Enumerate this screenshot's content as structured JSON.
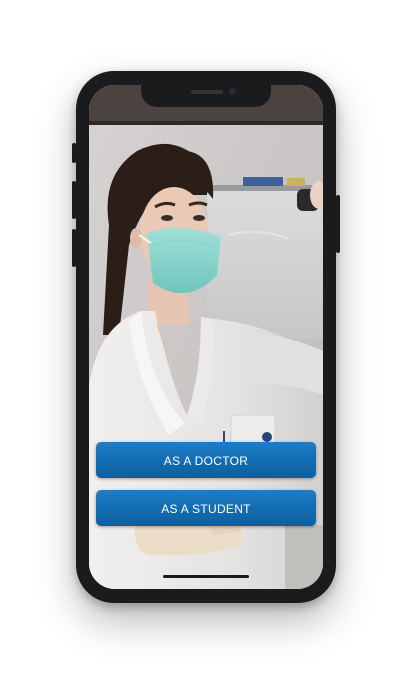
{
  "buttons": {
    "doctor_label": "AS A DOCTOR",
    "student_label": "AS A STUDENT"
  },
  "colors": {
    "button": "#0f6aae",
    "button_text": "#ffffff",
    "phone_frame": "#1b1b1d"
  },
  "background_image": {
    "subject": "woman in white lab coat wearing a surgical mask"
  }
}
